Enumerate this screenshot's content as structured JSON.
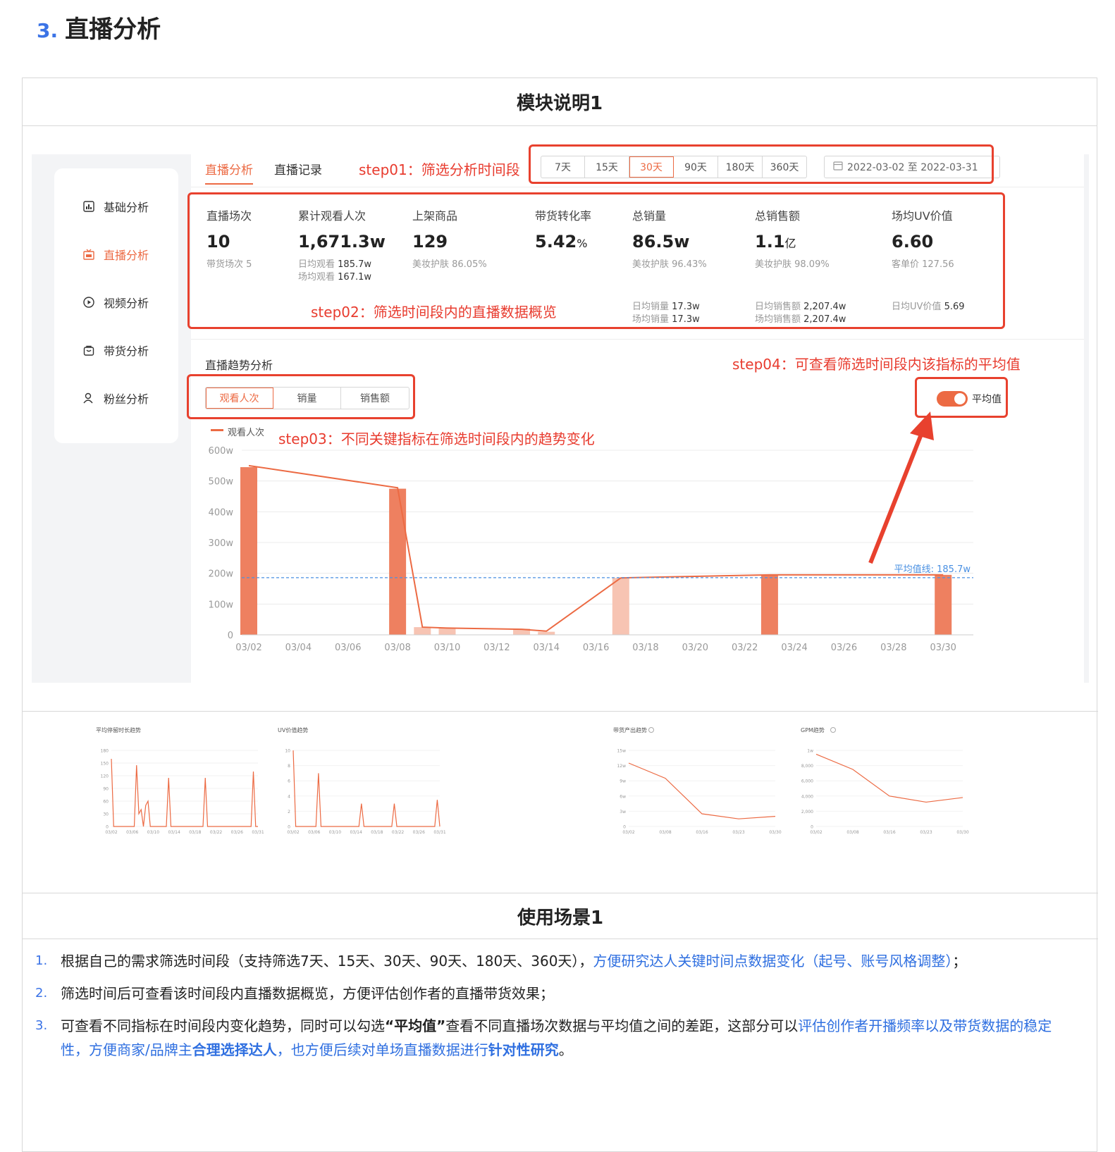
{
  "heading": {
    "num": "3.",
    "title": "直播分析"
  },
  "module_title": "模块说明1",
  "usage_title": "使用场景1",
  "sidebar": {
    "items": [
      {
        "label": "基础分析",
        "icon": "bar-chart-icon",
        "active": false
      },
      {
        "label": "直播分析",
        "icon": "live-icon",
        "active": true
      },
      {
        "label": "视频分析",
        "icon": "play-icon",
        "active": false
      },
      {
        "label": "带货分析",
        "icon": "bag-icon",
        "active": false
      },
      {
        "label": "粉丝分析",
        "icon": "user-icon",
        "active": false
      }
    ]
  },
  "tabs": [
    "直播分析",
    "直播记录"
  ],
  "annotations": {
    "step01": "step01：筛选分析时间段",
    "step02": "step02：筛选时间段内的直播数据概览",
    "step03": "step03：不同关键指标在筛选时间段内的趋势变化",
    "step04": "step04：可查看筛选时间段内该指标的平均值"
  },
  "range_options": [
    "7天",
    "15天",
    "30天",
    "90天",
    "180天",
    "360天"
  ],
  "range_selected": "30天",
  "date_range": "2022-03-02 至 2022-03-31",
  "metrics": [
    {
      "label": "直播场次",
      "value": "10",
      "sub": "带货场次 5"
    },
    {
      "label": "累计观看人次",
      "value": "1,671.3w",
      "sub_a_label": "日均观看",
      "sub_a_val": "185.7w",
      "sub_b_label": "场均观看",
      "sub_b_val": "167.1w"
    },
    {
      "label": "上架商品",
      "value": "129",
      "sub": "美妆护肤 86.05%"
    },
    {
      "label": "带货转化率",
      "value": "5.42",
      "unit": "%"
    },
    {
      "label": "总销量",
      "value": "86.5w",
      "sub": "美妆护肤 96.43%",
      "sub_a_label": "日均销量",
      "sub_a_val": "17.3w",
      "sub_b_label": "场均销量",
      "sub_b_val": "17.3w"
    },
    {
      "label": "总销售额",
      "value": "1.1",
      "unit": "亿",
      "sub": "美妆护肤 98.09%",
      "sub_a_label": "日均销售额",
      "sub_a_val": "2,207.4w",
      "sub_b_label": "场均销售额",
      "sub_b_val": "2,207.4w"
    },
    {
      "label": "场均UV价值",
      "value": "6.60",
      "sub": "客单价 127.56",
      "sub_a_label": "日均UV价值",
      "sub_a_val": "5.69"
    }
  ],
  "trend": {
    "title": "直播趋势分析",
    "segments": [
      "观看人次",
      "销量",
      "销售额"
    ],
    "segment_selected": "观看人次",
    "toggle_label": "平均值",
    "accent": "#ec6a43"
  },
  "chart_data": [
    {
      "type": "bar",
      "series": [
        {
          "name": "观看人次",
          "values": [
            545,
            0,
            0,
            0,
            0,
            0,
            475,
            25,
            22,
            0,
            0,
            20,
            10,
            0,
            0,
            185,
            0,
            0,
            0,
            0,
            0,
            195,
            0,
            0,
            0,
            0,
            0,
            0,
            195,
            0
          ]
        }
      ],
      "line_values": [
        550,
        null,
        null,
        null,
        null,
        null,
        478,
        25,
        22,
        null,
        null,
        18,
        12,
        null,
        null,
        185,
        null,
        null,
        null,
        null,
        null,
        195,
        null,
        null,
        null,
        null,
        null,
        null,
        195,
        null
      ],
      "x_ticks": [
        "03/02",
        "03/04",
        "03/06",
        "03/08",
        "03/10",
        "03/12",
        "03/14",
        "03/16",
        "03/18",
        "03/20",
        "03/22",
        "03/24",
        "03/26",
        "03/28",
        "03/30"
      ],
      "y_ticks": [
        "0",
        "100w",
        "200w",
        "300w",
        "400w",
        "500w",
        "600w"
      ],
      "ylim": [
        0,
        600
      ],
      "average": 185.7,
      "average_label": "平均值线: 185.7w",
      "legend": "top-left"
    },
    {
      "type": "line",
      "title": "平均停留时长趋势",
      "values": [
        160,
        0,
        0,
        0,
        0,
        0,
        0,
        0,
        0,
        0,
        0,
        145,
        30,
        40,
        0,
        50,
        60,
        0,
        0,
        0,
        0,
        0,
        0,
        0,
        0,
        115,
        0,
        0,
        0,
        0,
        0,
        0,
        0,
        0,
        0,
        0,
        0,
        0,
        0,
        0,
        0,
        115,
        0,
        0,
        0,
        0,
        0,
        0,
        0,
        0,
        0,
        0,
        0,
        0,
        0,
        0,
        0,
        0,
        0,
        0,
        0,
        0,
        130,
        0,
        0
      ],
      "y_ticks": [
        "0",
        "30",
        "60",
        "90",
        "120",
        "150",
        "180"
      ],
      "x_ticks": [
        "03/02",
        "03/06",
        "03/10",
        "03/14",
        "03/18",
        "03/22",
        "03/26",
        "03/31"
      ],
      "ylim": [
        0,
        180
      ]
    },
    {
      "type": "line",
      "title": "UV价值趋势",
      "values": [
        10,
        0,
        0,
        0,
        0,
        0,
        0,
        0,
        0,
        0,
        7,
        0,
        0,
        0,
        0,
        0,
        0,
        0,
        0,
        0,
        0,
        0,
        0,
        0,
        0,
        0,
        0,
        3,
        0,
        0,
        0,
        0,
        0,
        0,
        0,
        0,
        0,
        0,
        0,
        0,
        3,
        0,
        0,
        0,
        0,
        0,
        0,
        0,
        0,
        0,
        0,
        0,
        0,
        0,
        0,
        0,
        0,
        3.5,
        0
      ],
      "y_ticks": [
        "0",
        "2",
        "4",
        "6",
        "8",
        "10"
      ],
      "x_ticks": [
        "03/02",
        "03/06",
        "03/10",
        "03/14",
        "03/18",
        "03/22",
        "03/26",
        "03/31"
      ],
      "ylim": [
        0,
        10
      ]
    },
    {
      "type": "line",
      "title": "带货产出趋势",
      "values": [
        12.5,
        9.5,
        2.5,
        1.5,
        2
      ],
      "y_ticks": [
        "0",
        "3w",
        "6w",
        "9w",
        "12w",
        "15w"
      ],
      "x_ticks": [
        "03/02",
        "03/08",
        "03/16",
        "03/23",
        "03/30"
      ],
      "ylim": [
        0,
        15
      ]
    },
    {
      "type": "line",
      "title": "GPM趋势",
      "values": [
        9500,
        7500,
        4000,
        3200,
        3800
      ],
      "y_ticks": [
        "0",
        "2,000",
        "4,000",
        "6,000",
        "8,000",
        "1w"
      ],
      "x_ticks": [
        "03/02",
        "03/08",
        "03/16",
        "03/23",
        "03/30"
      ],
      "ylim": [
        0,
        10000
      ]
    }
  ],
  "usage": {
    "item1_plain": "根据自己的需求筛选时间段（支持筛选7天、15天、30天、90天、180天、360天），",
    "item1_blue": "方便研究达人关键时间点数据变化（起号、账号风格调整）",
    "item1_end": "；",
    "item2": "筛选时间后可查看该时间段内直播数据概览，方便评估创作者的直播带货效果；",
    "item3_a": "可查看不同指标在时间段内变化趋势，同时可以勾选",
    "item3_b": "“平均值”",
    "item3_c": "查看不同直播场次数据与平均值之间的差距，这部分可以",
    "item3_blue1": "评估创作者开播频率以及带货数据的稳定性，方便商家/品牌主",
    "item3_blue_bold1": "合理选择达人",
    "item3_blue2": "，也方便后续对单场直播数据进行",
    "item3_blue_bold2": "针对性研究",
    "item3_end": "。",
    "nums": [
      "1.",
      "2.",
      "3."
    ]
  }
}
